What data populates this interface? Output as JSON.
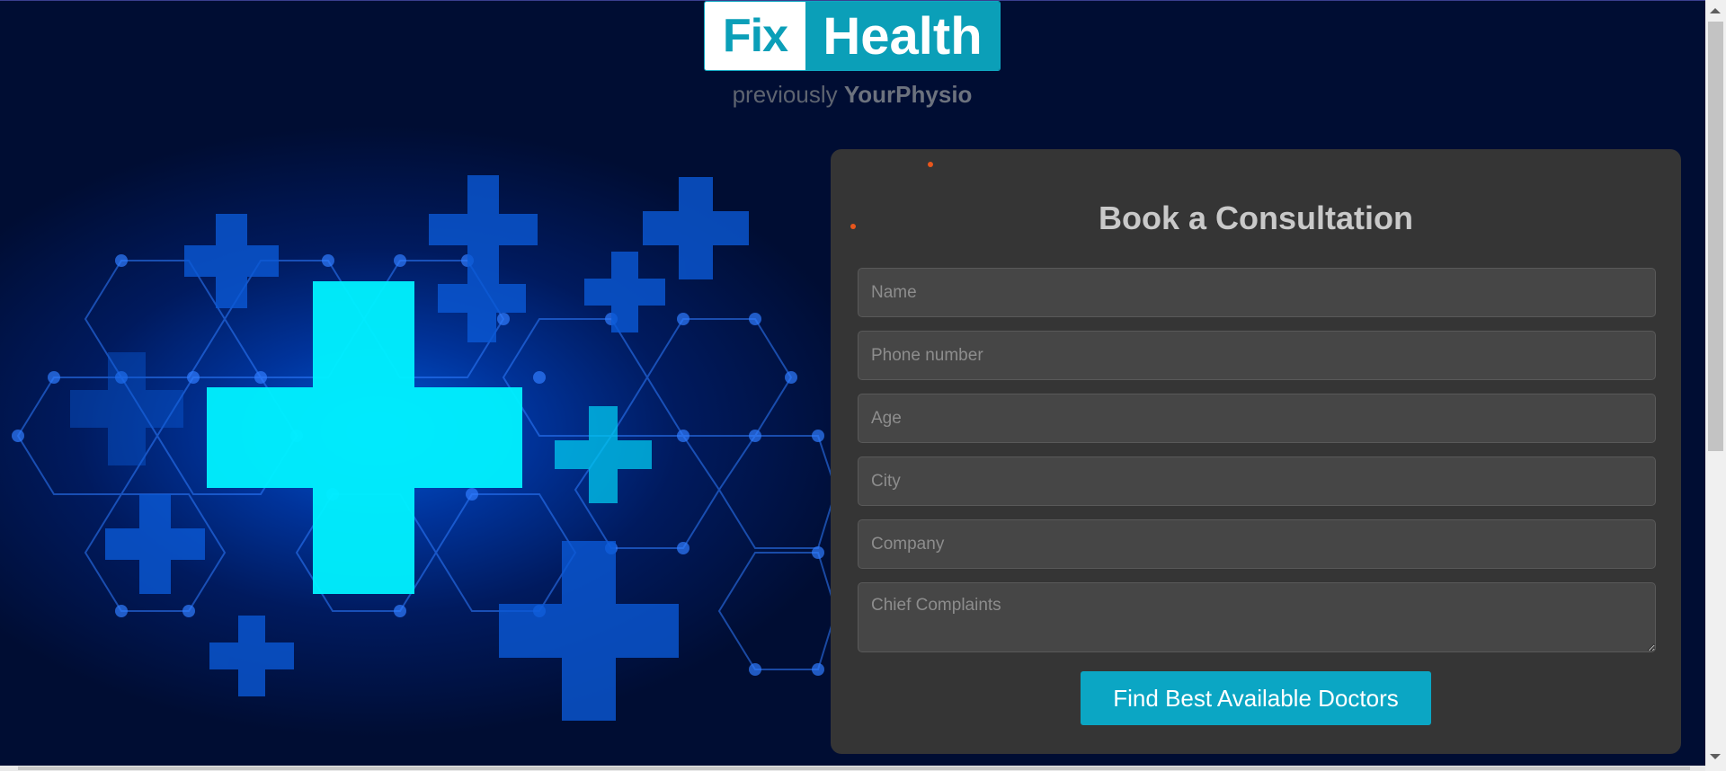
{
  "brand": {
    "logo_left": "Fix",
    "logo_right": "Health",
    "tagline_prefix": "previously",
    "tagline_name": "YourPhysio"
  },
  "form": {
    "title": "Book a Consultation",
    "fields": [
      {
        "name": "name-input",
        "placeholder": "Name"
      },
      {
        "name": "phone-input",
        "placeholder": "Phone number"
      },
      {
        "name": "age-input",
        "placeholder": "Age"
      },
      {
        "name": "city-input",
        "placeholder": "City"
      },
      {
        "name": "company-input",
        "placeholder": "Company"
      },
      {
        "name": "chief-complaints-input",
        "placeholder": "Chief Complaints"
      }
    ],
    "submit_label": "Find Best Available Doctors"
  },
  "hero": {
    "illustration": "medical-cross-icon",
    "colors": {
      "main_cross": "#00f2ff",
      "secondary_cross": "#0a59d6",
      "network": "#2f7cff"
    }
  },
  "theme": {
    "background": "#000d33",
    "card": "#353535",
    "accent": "#0ba6c4",
    "dot": "#e8561c"
  }
}
